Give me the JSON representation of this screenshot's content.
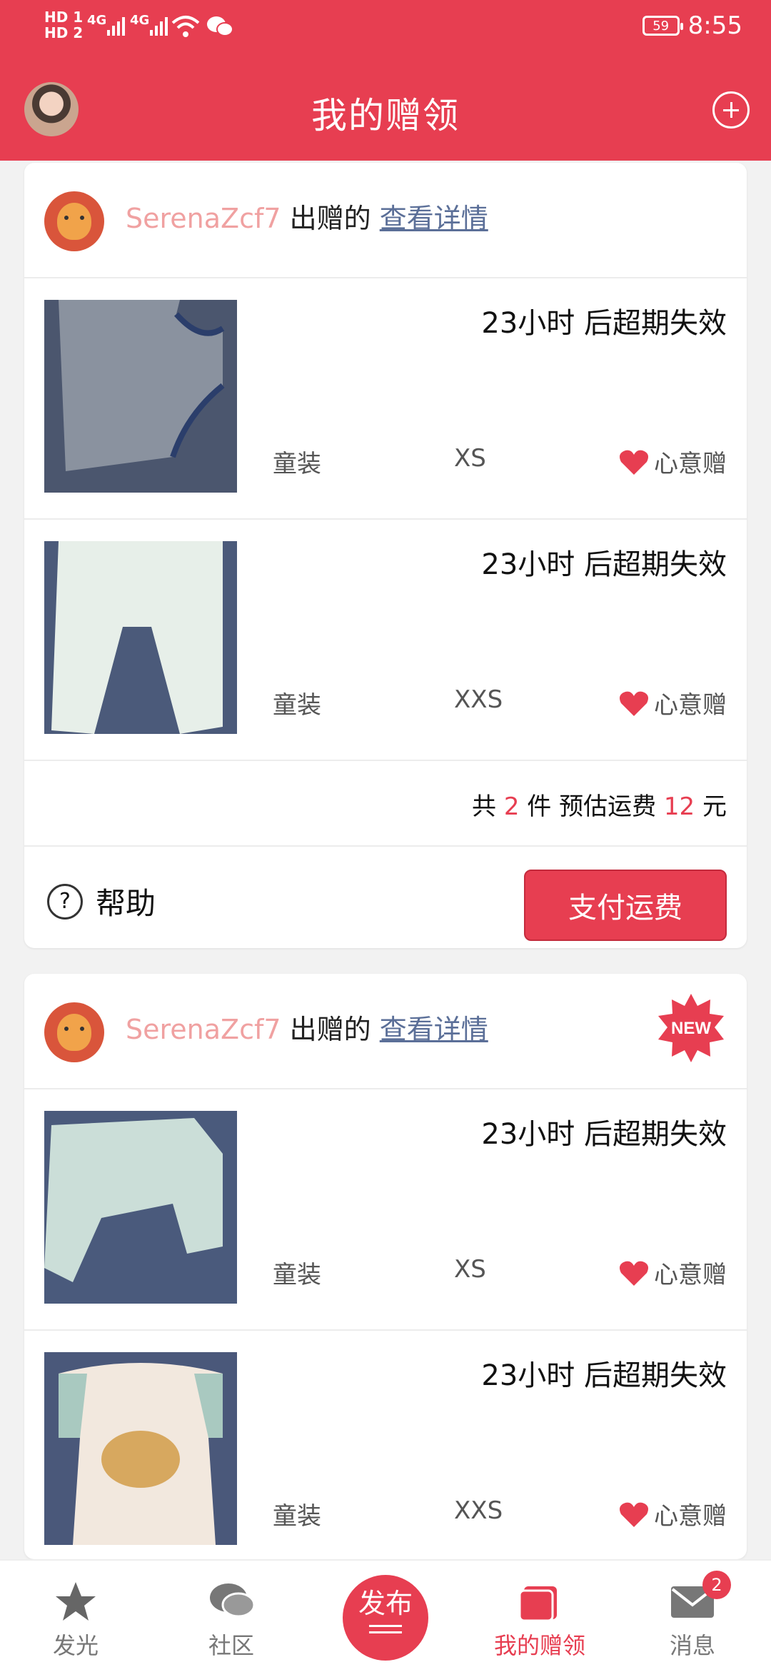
{
  "status_bar": {
    "time": "8:55",
    "battery": "59",
    "sim1": "HD 1",
    "sim2": "HD 2",
    "net": "4G"
  },
  "header": {
    "title": "我的赠领"
  },
  "orders": [
    {
      "donor": "SerenaZcf7",
      "donated_text": "出赠的",
      "detail_link": "查看详情",
      "items": [
        {
          "expire": "23小时 后超期失效",
          "category": "童装",
          "size": "XS",
          "tag": "心意赠"
        },
        {
          "expire": "23小时 后超期失效",
          "category": "童装",
          "size": "XXS",
          "tag": "心意赠"
        }
      ],
      "summary": {
        "prefix": "共",
        "count": "2",
        "unit": "件 预估运费",
        "fee": "12",
        "currency": "元"
      },
      "help_label": "帮助",
      "pay_label": "支付运费"
    },
    {
      "donor": "SerenaZcf7",
      "donated_text": "出赠的",
      "detail_link": "查看详情",
      "badge": "NEW",
      "items": [
        {
          "expire": "23小时 后超期失效",
          "category": "童装",
          "size": "XS",
          "tag": "心意赠"
        },
        {
          "expire": "23小时 后超期失效",
          "category": "童装",
          "size": "XXS",
          "tag": "心意赠"
        }
      ]
    }
  ],
  "nav": {
    "items": [
      "发光",
      "社区",
      "发布",
      "我的赠领",
      "消息"
    ],
    "active": "我的赠领",
    "message_badge": "2"
  },
  "colors": {
    "brand": "#e73e51",
    "donor_name": "#f0a1a1",
    "link": "#5b6f98"
  }
}
